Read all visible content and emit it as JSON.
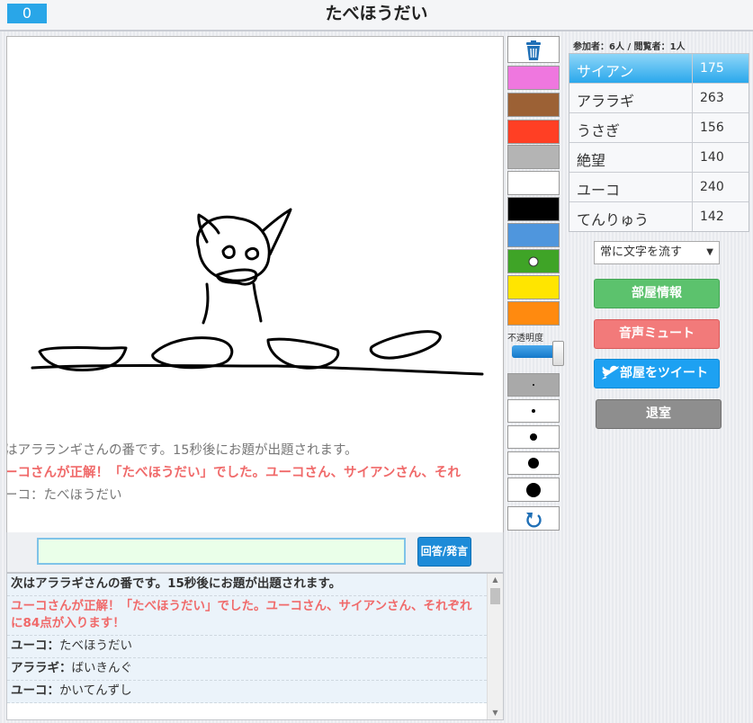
{
  "header": {
    "timer": "0",
    "title": "たべほうだい"
  },
  "canvas": {
    "messages": [
      {
        "text": "はアラランギさんの番です。15秒後にお題が出題されます。",
        "style": "grey"
      },
      {
        "text": "ーコさんが正解！「たべほうだい」でした。ユーコさん、サイアンさん、それ",
        "style": "red"
      },
      {
        "text": "ーコ：たべほうだい",
        "style": "grey"
      }
    ]
  },
  "answer": {
    "value": "",
    "button_label": "回答/発言"
  },
  "log": {
    "rows": [
      {
        "name": "",
        "text": "次はアララギさんの番です。15秒後にお題が出題されます。",
        "type": "sys"
      },
      {
        "name": "",
        "text": "ユーコさんが正解！「たべほうだい」でした。ユーコさん、サイアンさん、それぞれに84点が入ります！",
        "type": "correct"
      },
      {
        "name": "ユーコ：",
        "text": "たべほうだい",
        "type": "chat"
      },
      {
        "name": "アララギ：",
        "text": "ばいきんぐ",
        "type": "chat"
      },
      {
        "name": "ユーコ：",
        "text": "かいてんずし",
        "type": "chat"
      }
    ]
  },
  "tools": {
    "trash_icon": "trash-icon",
    "colors": [
      "#ef77df",
      "#9c6135",
      "#ff3f24",
      "#b4b4b4",
      "#ffffff",
      "#000000",
      "#4f96dd",
      "#3fa427",
      "#ffe500",
      "#ff8a0f"
    ],
    "selected_color_index": 7,
    "opacity_label": "不透明度",
    "opacity_value": 1.0,
    "pen_sizes": [
      2,
      4,
      8,
      12,
      16
    ],
    "selected_pen_index": 0,
    "undo_icon": "undo-icon"
  },
  "side": {
    "participants": "参加者：6人 / 閲覧者：1人",
    "players": [
      {
        "name": "サイアン",
        "score": "175",
        "active": true
      },
      {
        "name": "アララギ",
        "score": "263",
        "active": false
      },
      {
        "name": "うさぎ",
        "score": "156",
        "active": false
      },
      {
        "name": "絶望",
        "score": "140",
        "active": false
      },
      {
        "name": "ユーコ",
        "score": "240",
        "active": false
      },
      {
        "name": "てんりゅう",
        "score": "142",
        "active": false
      }
    ],
    "text_select": "常に文字を流す",
    "room_info": "部屋情報",
    "mute": "音声ミュート",
    "tweet": "部屋をツイート",
    "exit": "退室"
  }
}
